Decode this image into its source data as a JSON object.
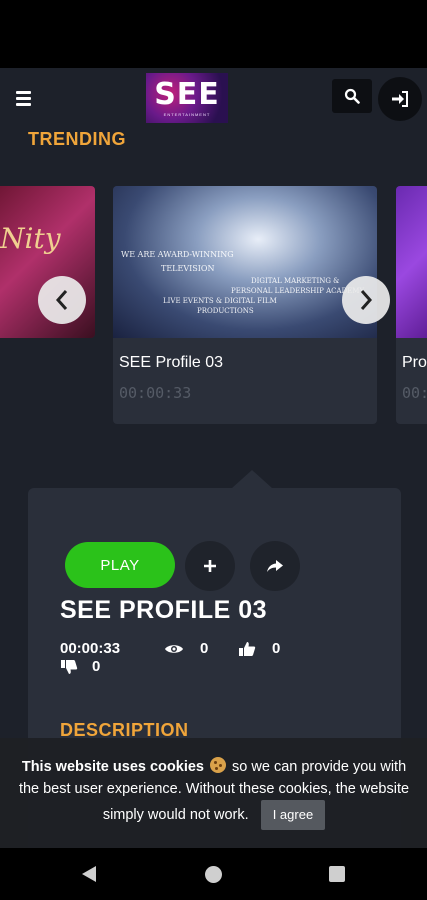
{
  "header": {
    "logo_text": "SEE",
    "logo_tagline": "ENTERTAINMENT"
  },
  "trending": {
    "title": "TRENDING",
    "left_card": {
      "thumb_text": "Nity"
    },
    "main_card": {
      "title": "SEE Profile 03",
      "duration": "00:00:33",
      "thumb_lines": [
        "WE ARE AWARD-WINNING",
        "TELEVISION",
        "DIGITAL MARKETING &",
        "PERSONAL LEADERSHIP ACADEMY",
        "LIVE EVENTS & DIGITAL FILM",
        "PRODUCTIONS"
      ]
    },
    "right_card": {
      "title": "Pro",
      "duration": "00:"
    }
  },
  "detail": {
    "play_label": "PLAY",
    "title": "SEE PROFILE 03",
    "duration": "00:00:33",
    "views": "0",
    "likes": "0",
    "dislikes": "0",
    "description_heading": "DESCRIPTION"
  },
  "cookie": {
    "bold_text": "This website uses cookies",
    "text_after_emoji": " so we can provide you with the best user experience. Without these cookies, the website simply would not work.",
    "agree_label": "I agree"
  },
  "colors": {
    "accent": "#f0a53a",
    "play_green": "#2bc21a",
    "background": "#1d212a",
    "card_bg": "#2a2f3a"
  },
  "icons": [
    "menu-icon",
    "search-icon",
    "sign-in-icon",
    "chevron-left-icon",
    "chevron-right-icon",
    "plus-icon",
    "share-icon",
    "eye-icon",
    "thumbs-up-icon",
    "thumbs-down-icon",
    "cookie-icon"
  ]
}
